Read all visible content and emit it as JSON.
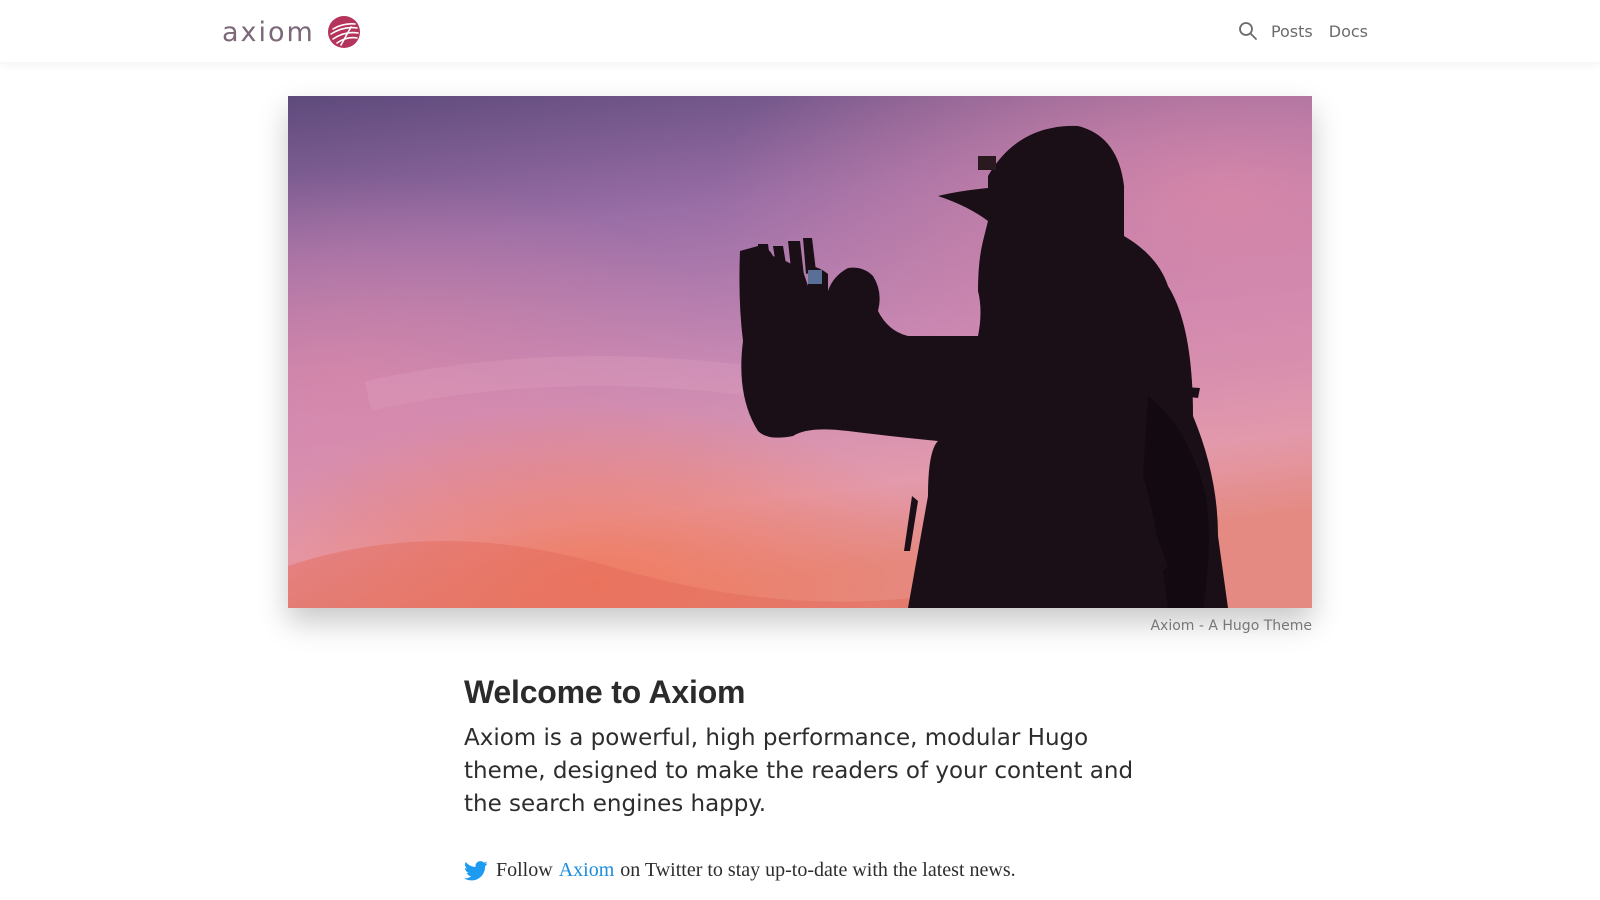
{
  "brand": {
    "name": "axiom",
    "logo_icon": "axiom-logo-mark-icon",
    "accent_color": "#b4345c",
    "text_color": "#7b6878"
  },
  "nav": {
    "search_icon": "search-icon",
    "items": [
      {
        "label": "Posts"
      },
      {
        "label": "Docs"
      }
    ]
  },
  "hero": {
    "image_desc_icon": "hero-photo",
    "caption": "Axiom - A Hugo Theme"
  },
  "article": {
    "title": "Welcome to Axiom",
    "lead": "Axiom is a powerful, high performance, modular Hugo theme, designed to make the readers of your content and the search engines happy.",
    "follow": {
      "icon": "twitter-icon",
      "prefix": "Follow",
      "link_text": "Axiom",
      "suffix": "on Twitter to stay up-to-date with the latest news.",
      "link_color": "#1d8cdc"
    }
  }
}
